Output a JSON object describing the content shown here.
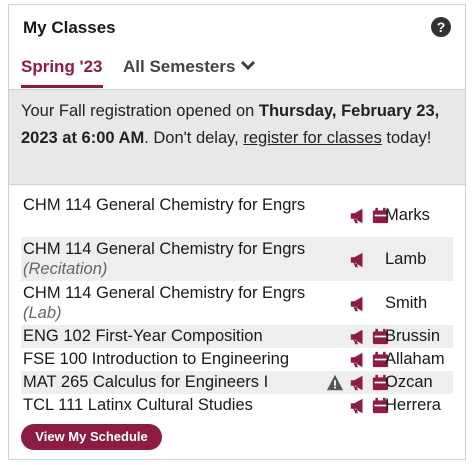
{
  "header": {
    "title": "My Classes",
    "help_glyph": "?"
  },
  "tabs": [
    {
      "label": "Spring '23",
      "active": true
    },
    {
      "label": "All Semesters",
      "active": false
    }
  ],
  "notice": {
    "prefix": "Your Fall registration opened on ",
    "date": "Thursday, February 23, 2023 at 6:00 AM",
    "middle": ". Don't delay, ",
    "link": "register for classes",
    "suffix": " today!"
  },
  "classes": [
    {
      "course": "CHM 114 General Chemistry for Engrs",
      "type": "",
      "instructor": "Marks",
      "icons": [
        "megaphone-icon",
        "calendar-icon"
      ]
    },
    {
      "course": "CHM 114 General Chemistry for Engrs",
      "type": "(Recitation)",
      "instructor": "Lamb",
      "icons": [
        "megaphone-icon"
      ]
    },
    {
      "course": "CHM 114 General Chemistry for Engrs",
      "type": "(Lab)",
      "instructor": "Smith",
      "icons": [
        "megaphone-icon"
      ]
    },
    {
      "course": "ENG 102 First-Year Composition",
      "type": "",
      "instructor": "Brussin",
      "icons": [
        "megaphone-icon",
        "calendar-icon"
      ]
    },
    {
      "course": "FSE 100 Introduction to Engineering",
      "type": "",
      "instructor": "Allaham",
      "icons": [
        "megaphone-icon",
        "calendar-icon"
      ]
    },
    {
      "course": "MAT 265 Calculus for Engineers I",
      "type": "",
      "instructor": "Ozcan",
      "icons": [
        "warning-icon",
        "megaphone-icon",
        "calendar-icon"
      ]
    },
    {
      "course": "TCL 111 Latinx Cultural Studies",
      "type": "",
      "instructor": "Herrera",
      "icons": [
        "megaphone-icon",
        "calendar-icon"
      ]
    }
  ],
  "button": {
    "label": "View My Schedule"
  },
  "colors": {
    "accent": "#8c1d40",
    "icon": "#8c1d40",
    "warning": "#555555"
  }
}
